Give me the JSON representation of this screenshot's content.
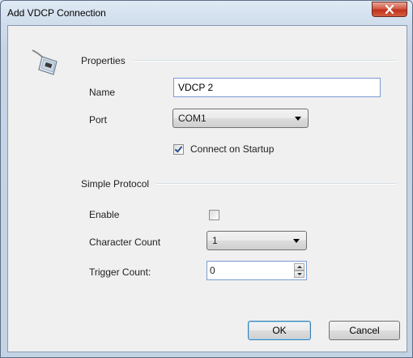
{
  "window": {
    "title": "Add VDCP Connection",
    "close_icon": "close-icon"
  },
  "properties": {
    "header": "Properties",
    "name_label": "Name",
    "name_value": "VDCP 2",
    "port_label": "Port",
    "port_value": "COM1",
    "connect_on_startup_label": "Connect on Startup",
    "connect_on_startup_checked": true
  },
  "simple_protocol": {
    "header": "Simple Protocol",
    "enable_label": "Enable",
    "enable_checked": false,
    "character_count_label": "Character Count",
    "character_count_value": "1",
    "trigger_count_label": "Trigger Count:",
    "trigger_count_value": "0"
  },
  "buttons": {
    "ok_label": "OK",
    "cancel_label": "Cancel"
  },
  "icons": {
    "app_icon": "serial-connector-icon"
  },
  "colors": {
    "close_button": "#c7432b",
    "title_bar": "#cfdceb",
    "client_bg": "#f0f0f0",
    "input_border": "#7a9cd3"
  }
}
